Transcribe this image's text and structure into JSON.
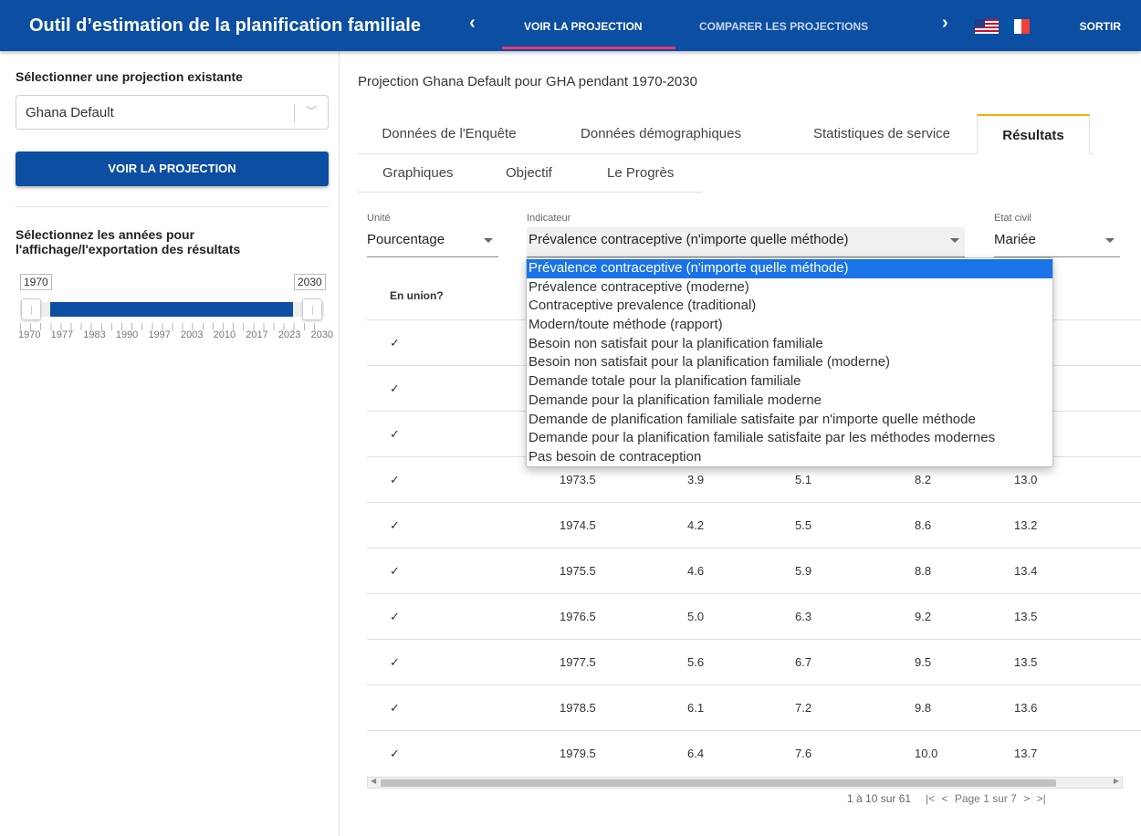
{
  "header": {
    "title": "Outil d’estimation de la planification familiale",
    "nav_tabs": [
      "VOIR LA PROJECTION",
      "COMPARER LES PROJECTIONS"
    ],
    "active_tab": "VOIR LA PROJECTION",
    "prev_icon": "chevron-left-icon",
    "next_icon": "chevron-right-icon",
    "languages": [
      "us-flag",
      "fr-flag"
    ],
    "logout_label": "SORTIR",
    "bar_color": "#0b4ea2",
    "active_underline_color": "#e53b6f"
  },
  "sidebar": {
    "select_label": "Sélectionner une projection existante",
    "selected_projection": "Ghana Default",
    "view_button": "VOIR LA PROJECTION",
    "years_label": "Sélectionnez les années pour l'affichage/l'exportation des résultats",
    "range_start": "1970",
    "range_end": "2030",
    "tick_labels": [
      "1970",
      "1977",
      "1983",
      "1990",
      "1997",
      "2003",
      "2010",
      "2017",
      "2023",
      "2030"
    ]
  },
  "main": {
    "projection_title": "Projection Ghana Default pour GHA pendant 1970-2030",
    "tabs_row1": [
      "Données de l'Enquête",
      "Données démographiques",
      "Statistiques de service",
      "Résultats"
    ],
    "active_tab": "Résultats",
    "tabs_row2": [
      "Graphiques",
      "Objectif",
      "Le Progrès"
    ],
    "unit": {
      "label": "Unité",
      "value": "Pourcentage"
    },
    "indicator": {
      "label": "Indicateur",
      "value": "Prévalence contraceptive (n'importe quelle méthode)"
    },
    "marital": {
      "label": "Etat civil",
      "value": "Mariée"
    }
  },
  "dropdown": {
    "options": [
      "Prévalence contraceptive (n'importe quelle méthode)",
      "Prévalence contraceptive (moderne)",
      "Contraceptive prevalence (traditional)",
      "Modern/toute méthode (rapport)",
      "Besoin non satisfait pour la planification familiale",
      "Besoin non satisfait pour la planification familiale (moderne)",
      "Demande totale pour la planification familiale",
      "Demande pour la planification familiale moderne",
      "Demande de planification familiale satisfaite par n'importe quelle méthode",
      "Demande pour la planification familiale satisfaite par les méthodes modernes",
      "Pas besoin de contraception"
    ],
    "selected_index": 0,
    "highlight_color": "#1a73e8"
  },
  "table": {
    "columns": [
      "En union?"
    ],
    "rows": [
      [
        "✓",
        "",
        "",
        "",
        "",
        ""
      ],
      [
        "✓",
        "",
        "",
        "",
        "",
        ""
      ],
      [
        "✓",
        "",
        "",
        "",
        "",
        ""
      ],
      [
        "✓",
        "1973.5",
        "3.9",
        "5.1",
        "8.2",
        "13.0"
      ],
      [
        "✓",
        "1974.5",
        "4.2",
        "5.5",
        "8.6",
        "13.2"
      ],
      [
        "✓",
        "1975.5",
        "4.6",
        "5.9",
        "8.8",
        "13.4"
      ],
      [
        "✓",
        "1976.5",
        "5.0",
        "6.3",
        "9.2",
        "13.5"
      ],
      [
        "✓",
        "1977.5",
        "5.6",
        "6.7",
        "9.5",
        "13.5"
      ],
      [
        "✓",
        "1978.5",
        "6.1",
        "7.2",
        "9.8",
        "13.6"
      ],
      [
        "✓",
        "1979.5",
        "6.4",
        "7.6",
        "10.0",
        "13.7"
      ]
    ]
  },
  "pagination": {
    "range_text": "1 à 10 sur 61",
    "first": "|<",
    "prev": "<",
    "page_text": "Page 1 sur 7",
    "next": ">",
    "last": ">|"
  }
}
